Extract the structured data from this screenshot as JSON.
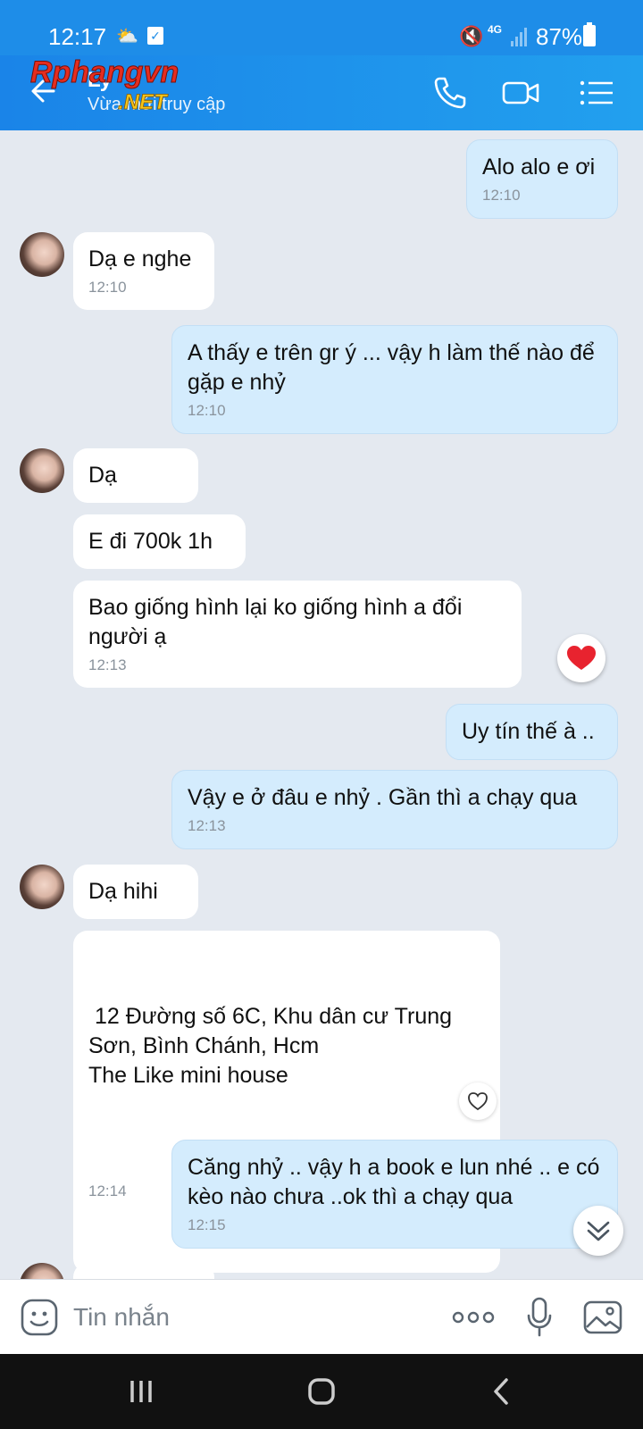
{
  "status_bar": {
    "time": "12:17",
    "weather_icon": "sun-cloud-icon",
    "network": "4G",
    "battery": "87%"
  },
  "header": {
    "contact_name": "Ly",
    "presence": "Vừa mới truy cập",
    "watermark": {
      "line1": "Rphangvn",
      "line2": ".NET"
    }
  },
  "messages": [
    {
      "dir": "out",
      "text": "Alo alo e ơi",
      "time": "12:10"
    },
    {
      "dir": "in",
      "text": "Dạ e nghe",
      "time": "12:10"
    },
    {
      "dir": "out",
      "text": "A thấy e trên gr ý ... vậy h làm thế nào để gặp e nhỷ",
      "time": "12:10"
    },
    {
      "dir": "in",
      "text": "Dạ",
      "time": ""
    },
    {
      "dir": "in",
      "text": "E đi 700k 1h",
      "time": ""
    },
    {
      "dir": "in",
      "text": "Bao giống hình lại ko giống hình a đổi người ạ",
      "time": "12:13",
      "reaction": "heart"
    },
    {
      "dir": "out",
      "text": "Uy tín thế à ..",
      "time": ""
    },
    {
      "dir": "out",
      "text": "Vậy e ở đâu e nhỷ . Gần thì a chạy qua",
      "time": "12:13"
    },
    {
      "dir": "in",
      "text": "Dạ hihi",
      "time": ""
    },
    {
      "dir": "in",
      "text": " 12 Đường số 6C, Khu dân cư Trung Sơn, Bình Chánh, Hcm\nThe Like mini house",
      "time": "12:14"
    },
    {
      "dir": "out",
      "text": "Căng nhỷ .. vậy h a book e lun nhé .. e có kèo nào chưa ..ok thì a chạy qua",
      "time": "12:15"
    }
  ],
  "input": {
    "placeholder": "Tin nhắn"
  },
  "colors": {
    "header": "#1e8de8",
    "outgoing_bubble": "#d4ecfd",
    "incoming_bubble": "#ffffff",
    "background": "#e4e9f0"
  }
}
